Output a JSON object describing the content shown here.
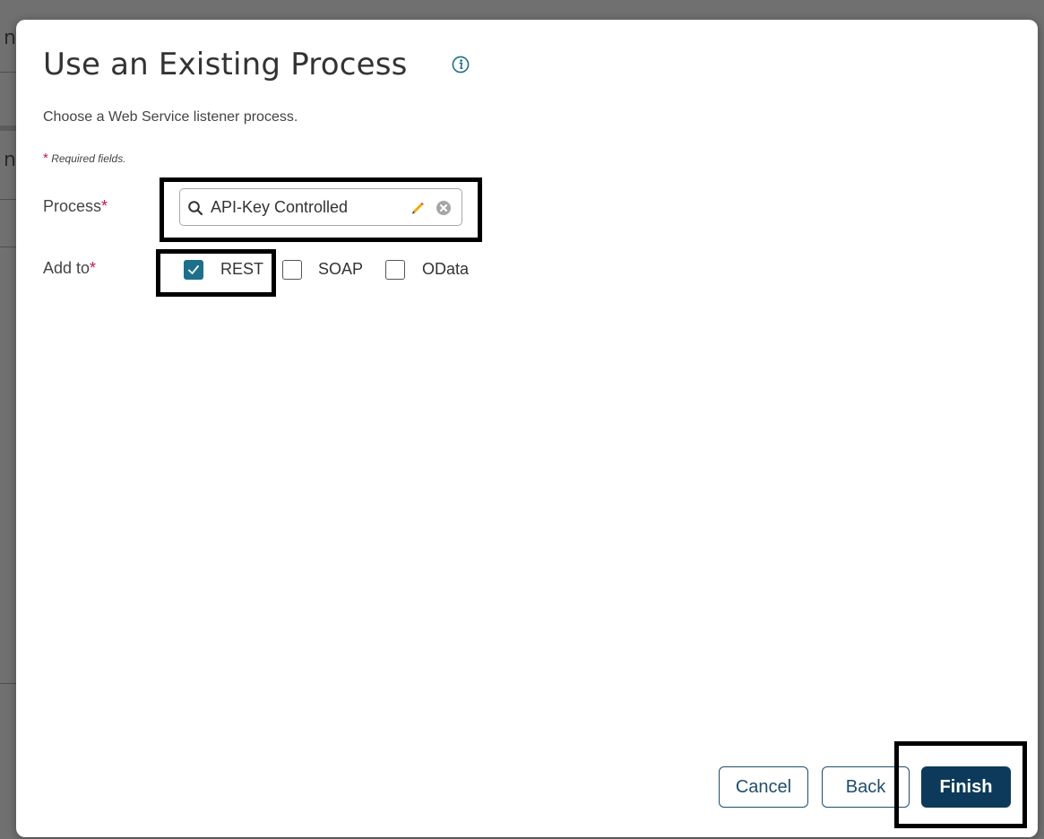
{
  "modal": {
    "title": "Use an Existing Process",
    "info_icon": "info-icon",
    "subtitle": "Choose a Web Service listener process.",
    "required_star": "*",
    "required_note": "Required fields."
  },
  "process_field": {
    "label": "Process",
    "star": "*",
    "value": "API-Key Controlled",
    "icons": [
      "search-icon",
      "pencil-icon",
      "clear-icon"
    ]
  },
  "add_to": {
    "label": "Add to",
    "star": "*",
    "options": [
      {
        "label": "REST",
        "checked": true
      },
      {
        "label": "SOAP",
        "checked": false
      },
      {
        "label": "OData",
        "checked": false
      }
    ]
  },
  "buttons": {
    "cancel": "Cancel",
    "back": "Back",
    "finish": "Finish"
  },
  "colors": {
    "accent": "#0d3a5a",
    "checkbox_checked": "#1d6f8a",
    "required": "#c2185b",
    "highlight": "#000000"
  }
}
